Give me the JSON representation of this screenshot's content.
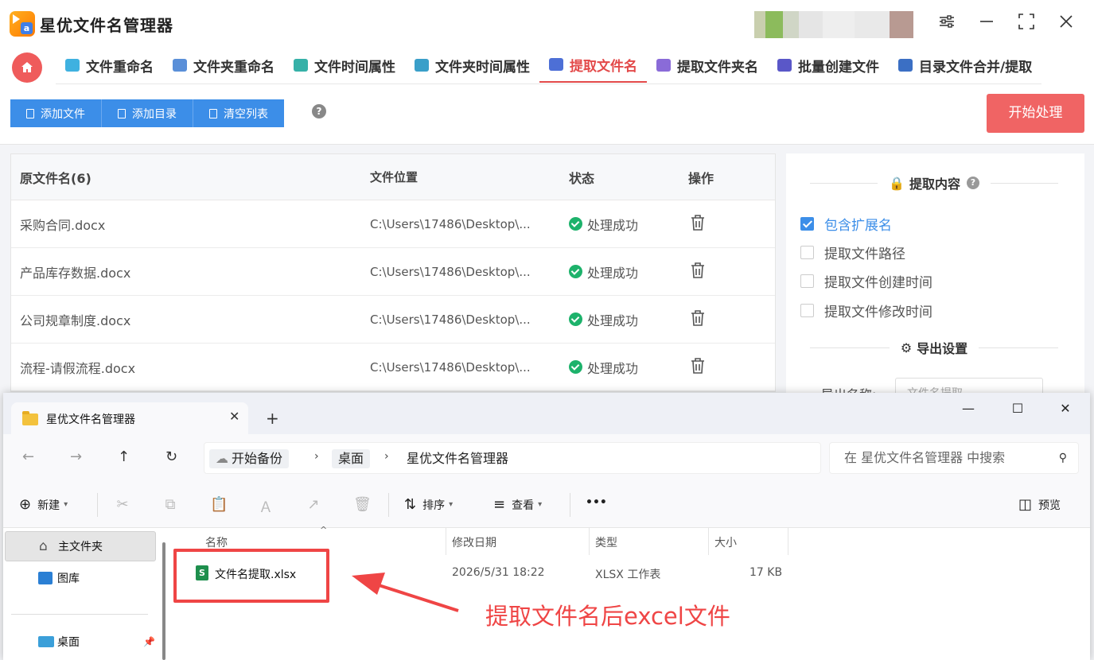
{
  "app": {
    "title": "星优文件名管理器",
    "logo_letter": "a"
  },
  "nav": {
    "tabs": [
      {
        "label": "文件重命名",
        "color": "#3fb1e0"
      },
      {
        "label": "文件夹重命名",
        "color": "#5a8fd8"
      },
      {
        "label": "文件时间属性",
        "color": "#36b1a8"
      },
      {
        "label": "文件夹时间属性",
        "color": "#3a9fc9"
      },
      {
        "label": "提取文件名",
        "color": "#4d6fd6",
        "active": true
      },
      {
        "label": "提取文件夹名",
        "color": "#8a6bd8"
      },
      {
        "label": "批量创建文件",
        "color": "#5a57c8"
      },
      {
        "label": "目录文件合并/提取",
        "color": "#3b6fc4"
      }
    ]
  },
  "toolbar": {
    "add_file": "添加文件",
    "add_dir": "添加目录",
    "clear_list": "清空列表",
    "help": "?",
    "start": "开始处理"
  },
  "table": {
    "headers": {
      "name": "原文件名(6)",
      "location": "文件位置",
      "status": "状态",
      "action": "操作"
    },
    "rows": [
      {
        "name": "采购合同.docx",
        "location": "C:\\Users\\17486\\Desktop\\...",
        "status": "处理成功"
      },
      {
        "name": "产品库存数据.docx",
        "location": "C:\\Users\\17486\\Desktop\\...",
        "status": "处理成功"
      },
      {
        "name": "公司规章制度.docx",
        "location": "C:\\Users\\17486\\Desktop\\...",
        "status": "处理成功"
      },
      {
        "name": "流程-请假流程.docx",
        "location": "C:\\Users\\17486\\Desktop\\...",
        "status": "处理成功"
      }
    ]
  },
  "panel": {
    "extract_title": "提取内容",
    "help": "?",
    "options": [
      {
        "label": "包含扩展名",
        "checked": true
      },
      {
        "label": "提取文件路径",
        "checked": false
      },
      {
        "label": "提取文件创建时间",
        "checked": false
      },
      {
        "label": "提取文件修改时间",
        "checked": false
      }
    ],
    "export_title": "导出设置",
    "export_name_label": "导出名称:",
    "export_name_value": "文件名提取"
  },
  "explorer": {
    "tab_title": "星优文件名管理器",
    "breadcrumbs": [
      "开始备份",
      "桌面",
      "星优文件名管理器"
    ],
    "search_placeholder": "在 星优文件名管理器 中搜索",
    "cmd": {
      "new": "新建",
      "sort": "排序",
      "view": "查看",
      "more": "•••",
      "preview": "预览"
    },
    "sidebar": [
      {
        "label": "主文件夹",
        "selected": true
      },
      {
        "label": "图库",
        "selected": false
      },
      {
        "label": "桌面",
        "selected": false
      }
    ],
    "columns": {
      "name": "名称",
      "modified": "修改日期",
      "type": "类型",
      "size": "大小"
    },
    "files": [
      {
        "name": "文件名提取.xlsx",
        "modified": "2026/5/31 18:22",
        "type": "XLSX 工作表",
        "size": "17 KB"
      }
    ]
  },
  "annotation": {
    "text": "提取文件名后excel文件",
    "color": "#ef4545"
  }
}
